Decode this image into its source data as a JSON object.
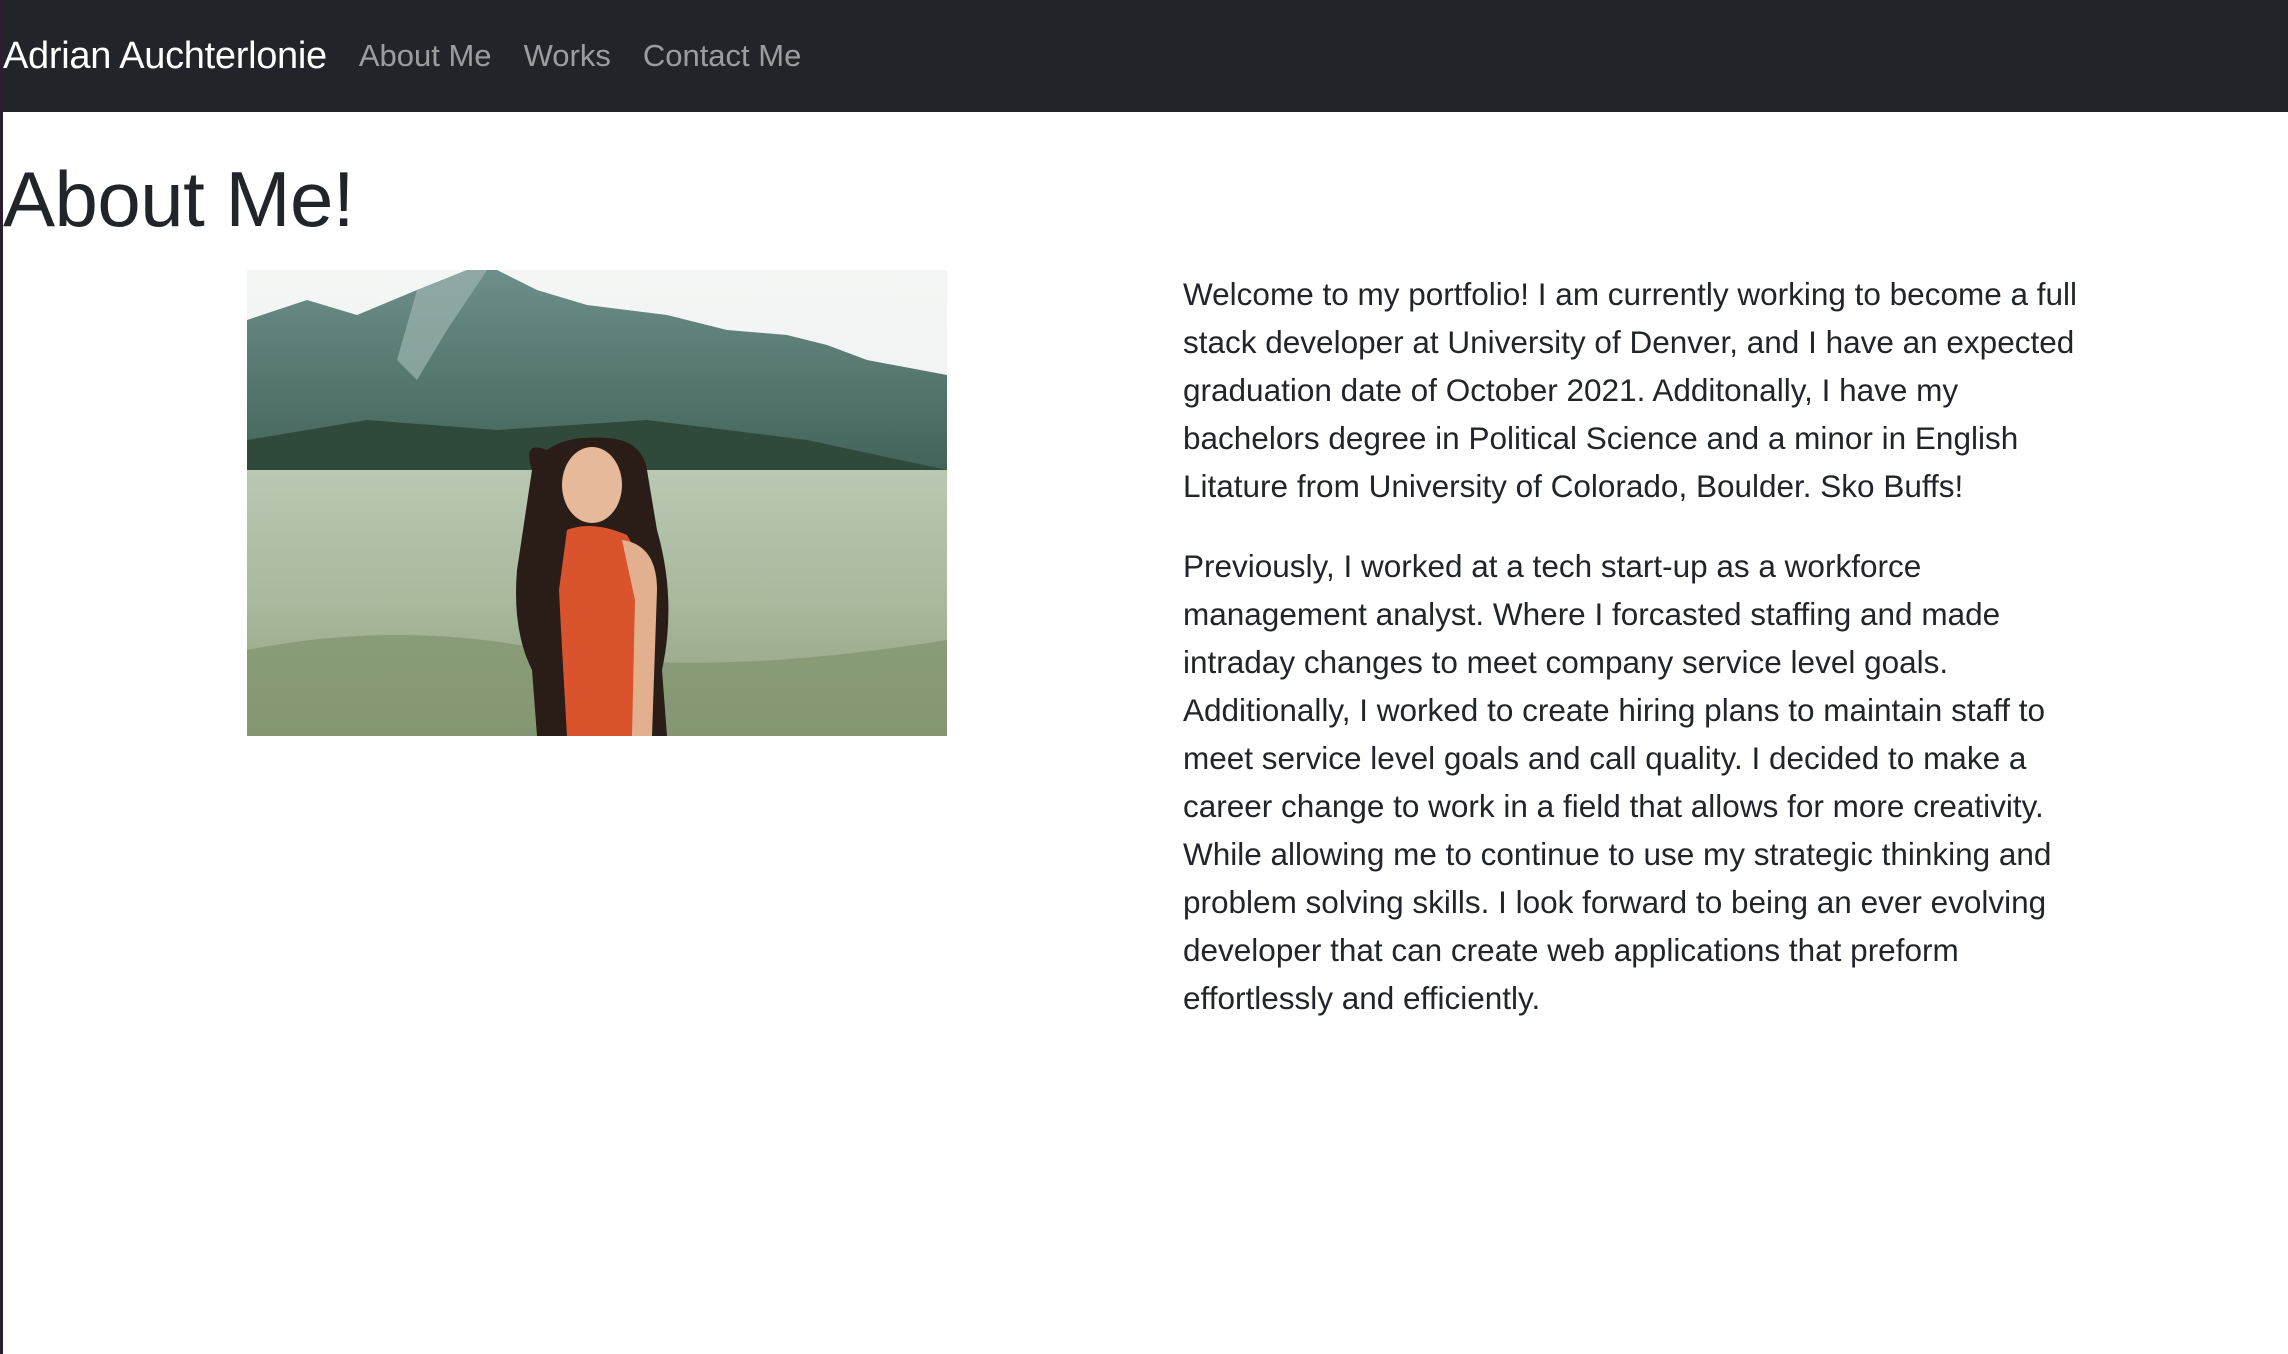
{
  "navbar": {
    "brand": "Adrian Auchterlonie",
    "links": [
      {
        "label": "About Me"
      },
      {
        "label": "Works"
      },
      {
        "label": "Contact Me"
      }
    ]
  },
  "main": {
    "title": "About Me!",
    "photo_icon": "portrait-photo",
    "paragraphs": [
      "Welcome to my portfolio! I am currently working to become a full stack developer at University of Denver, and I have an expected graduation date of October 2021. Additonally, I have my bachelors degree in Political Science and a minor in English Litature from University of Colorado, Boulder. Sko Buffs!",
      "Previously, I worked at a tech start-up as a workforce management analyst. Where I forcasted staffing and made intraday changes to meet company service level goals. Additionally, I worked to create hiring plans to maintain staff to meet service level goals and call quality. I decided to make a career change to work in a field that allows for more creativity. While allowing me to continue to use my strategic thinking and problem solving skills. I look forward to being an ever evolving developer that can create web applications that preform effortlessly and efficiently."
    ]
  },
  "colors": {
    "navbar_bg": "#212529",
    "brand": "#ffffff",
    "nav_link": "#8c8e91",
    "text": "#212529"
  }
}
